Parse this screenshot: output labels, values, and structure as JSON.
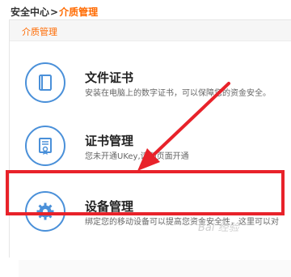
{
  "breadcrumb": {
    "root": "安全中心",
    "separator": ">",
    "current": "介质管理"
  },
  "panel": {
    "title": "介质管理"
  },
  "items": [
    {
      "title": "文件证书",
      "desc": "安装在电脑上的数字证书，可以保障您的资金安全。",
      "icon": "book-icon"
    },
    {
      "title": "证书管理",
      "desc": "您未开通UKey,请到页面开通",
      "icon": "certificate-icon"
    },
    {
      "title": "设备管理",
      "desc": "绑定您的移动设备可以提高您资金安全性，这里可以对",
      "icon": "gear-icon"
    }
  ],
  "watermark": "Bai 经验",
  "colors": {
    "accent": "#ff6a00",
    "icon_blue": "#4a90d9",
    "highlight_red": "#e8222a"
  }
}
